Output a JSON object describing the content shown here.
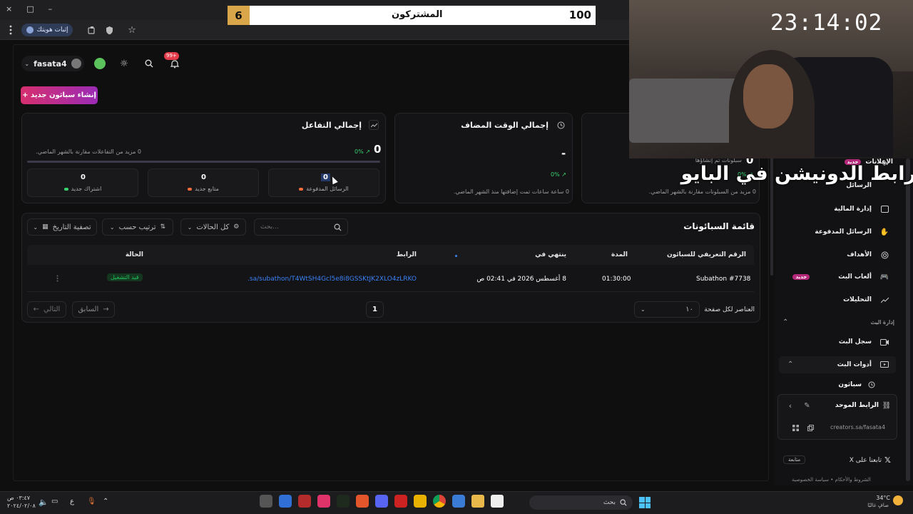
{
  "browser": {
    "ext_chip": "إثبات هويتك",
    "win_controls": [
      "×",
      "□",
      "–"
    ]
  },
  "overlay": {
    "score_left": "6",
    "score_label": "المشتركون",
    "score_right": "100",
    "clock": "23:14:02",
    "bio_text": "رابط الدونيشن في البايو"
  },
  "header": {
    "username": "fasata4",
    "notif_badge": "99+",
    "create_button": "+ إنشاء سباثون جديد"
  },
  "stats": {
    "engagement": {
      "title": "إجمالي التفاعل",
      "value": "0",
      "change": "0% ↗",
      "note": "0 مزيد من التفاعلات مقارنة بالشهر الماضي.",
      "sub": [
        {
          "value": "0",
          "label": "الرسائل المدفوعة",
          "color": "#f26b3a"
        },
        {
          "value": "0",
          "label": "متابع جديد",
          "color": "#f26b3a"
        },
        {
          "value": "0",
          "label": "اشتراك جديد",
          "color": "#3bd16f"
        }
      ]
    },
    "time": {
      "title": "إجمالي الوقت المضاف",
      "value": "-",
      "change": "0% ↗",
      "note": "0 ساعة ساعات تمت إضافتها منذ الشهر الماضي."
    },
    "subs": {
      "value": "0",
      "sub_note": "سبلونات تم إنشاؤها",
      "change": "0% ↗",
      "note": "0 مزيد من السبلونات مقارنة بالشهر الماضي."
    }
  },
  "list": {
    "title": "قائمة السبائونات",
    "search_placeholder": "بحث...",
    "filter_status": "كل الحالات",
    "sort": "ترتيب حسب",
    "date_filter": "تصفية التاريخ",
    "columns": [
      "الرقم التعريفي للسبائون",
      "المدة",
      "ينتهي في",
      "الرابط",
      "الحالة"
    ],
    "rows": [
      {
        "id": "Subathon #7738",
        "duration": "01:30:00",
        "ends": "8 أغسطس 2026 في 02:41 ص",
        "link": "sa/subathon/T4WtSH4Gcl5e8i8GSSKtJK2XLO4zLRKO...",
        "status": "قيد التشغيل"
      }
    ],
    "pagination": {
      "per_page_label": "العناصر لكل صفحة",
      "per_page": "١٠",
      "page": "1",
      "prev": "السابق",
      "next": "التالي"
    }
  },
  "sidebar": {
    "items_top": [
      {
        "label": "الإعلانات",
        "badge": "جديد"
      },
      {
        "label": "الرسائل",
        "badge": ""
      },
      {
        "label": "إدارة المالية",
        "badge": ""
      },
      {
        "label": "الرسائل المدفوعة",
        "badge": ""
      },
      {
        "label": "الأهداف",
        "badge": ""
      },
      {
        "label": "ألعاب البث",
        "badge": "جديد"
      },
      {
        "label": "التحليلات",
        "badge": ""
      }
    ],
    "section_stream": "إدارة البث",
    "stream_log": "سجل البث",
    "stream_tools": "أدوات البث",
    "subathon": "سباثون",
    "unified_link_title": "الرابط الموحد",
    "unified_link": "creators.sa/fasata4",
    "follow_x": "تابعنا على X",
    "follow_btn": "متابعة",
    "footer": "الشروط والأحكام  •  سياسة الخصوصية"
  },
  "taskbar": {
    "search": "بحث",
    "weather_temp": "34°C",
    "weather_desc": "صافٍ غالبًا",
    "time": "٠٣:٤٧ ص",
    "date": "٢٠٢٤/٠٢/٠٨",
    "lang": "ع"
  },
  "colors": {
    "accent": "#c02b8a",
    "link": "#3b82f6",
    "green": "#22c55e",
    "red": "#ef4444"
  }
}
